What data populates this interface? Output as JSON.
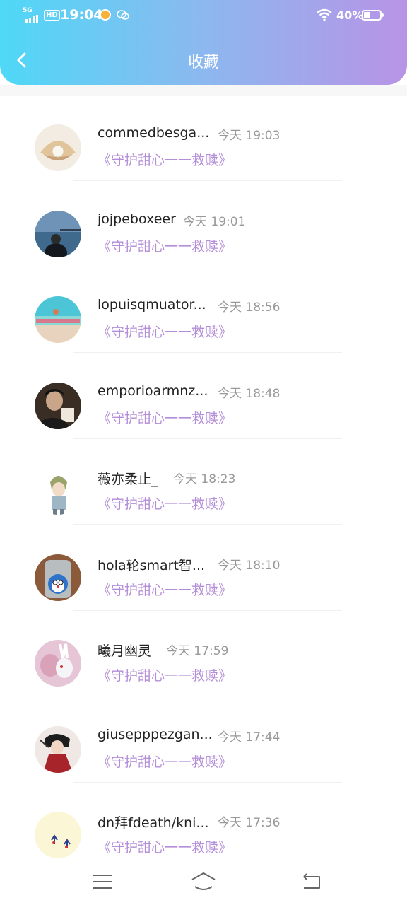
{
  "status_bar": {
    "network": "5G",
    "hd": "HD",
    "time": "19:04",
    "battery": "40%",
    "battery_level": 0.4
  },
  "header": {
    "title": "收藏"
  },
  "items": [
    {
      "name": "commedbesga...",
      "time": "今天 19:03",
      "book": "《守护甜心一一救赎》"
    },
    {
      "name": "jojpeboxeer",
      "time": "今天 19:01",
      "book": "《守护甜心一一救赎》"
    },
    {
      "name": "lopuisqmuator...",
      "time": "今天 18:56",
      "book": "《守护甜心一一救赎》"
    },
    {
      "name": "emporioarmnz...",
      "time": "今天 18:48",
      "book": "《守护甜心一一救赎》"
    },
    {
      "name": "薇亦柔止_",
      "time": "今天 18:23",
      "book": "《守护甜心一一救赎》"
    },
    {
      "name": "hola轮smart智...",
      "time": "今天 18:10",
      "book": "《守护甜心一一救赎》"
    },
    {
      "name": "曦月幽灵",
      "time": "今天 17:59",
      "book": "《守护甜心一一救赎》"
    },
    {
      "name": "giusepppezgan...",
      "time": "今天 17:44",
      "book": "《守护甜心一一救赎》"
    },
    {
      "name": "dn拜fdeath/kni...",
      "time": "今天 17:36",
      "book": "《守护甜心一一救赎》"
    }
  ]
}
